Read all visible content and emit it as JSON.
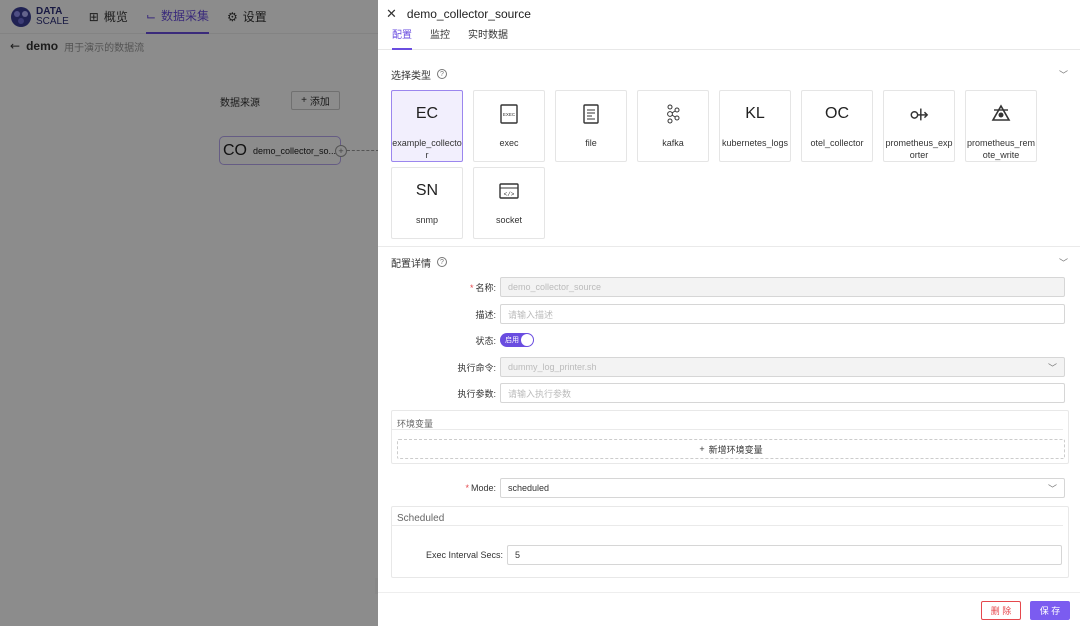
{
  "app": {
    "logo_line1": "DATA",
    "logo_line2": "SCALE",
    "nav": [
      {
        "label": "概览",
        "icon": "grid-icon"
      },
      {
        "label": "数据采集",
        "icon": "chart-icon",
        "active": true
      },
      {
        "label": "设置",
        "icon": "gear-icon"
      }
    ],
    "flow_name": "demo",
    "flow_desc": "用于演示的数据流",
    "canvas_label": "数据来源",
    "add_label": "添加",
    "node": {
      "abbr": "CO",
      "name": "demo_collector_so..."
    }
  },
  "drawer": {
    "title": "demo_collector_source",
    "tabs": [
      {
        "label": "配置",
        "active": true
      },
      {
        "label": "监控"
      },
      {
        "label": "实时数据"
      }
    ],
    "type_section_title": "选择类型",
    "types": [
      {
        "abbr": "EC",
        "label": "example_collector",
        "selected": true
      },
      {
        "icon": "exec-icon",
        "label": "exec"
      },
      {
        "icon": "file-icon",
        "label": "file"
      },
      {
        "icon": "kafka-icon",
        "label": "kafka"
      },
      {
        "abbr": "KL",
        "label": "kubernetes_logs"
      },
      {
        "abbr": "OC",
        "label": "otel_collector"
      },
      {
        "icon": "prometheus-exporter-icon",
        "label": "prometheus_exporter"
      },
      {
        "icon": "prometheus-remote-write-icon",
        "label": "prometheus_remote_write"
      },
      {
        "abbr": "SN",
        "label": "snmp"
      },
      {
        "icon": "socket-icon",
        "label": "socket"
      }
    ],
    "detail_section_title": "配置详情",
    "form": {
      "name_label": "名称:",
      "name_value": "demo_collector_source",
      "desc_label": "描述:",
      "desc_placeholder": "请输入描述",
      "status_label": "状态:",
      "status_toggle_text": "启用",
      "cmd_label": "执行命令:",
      "cmd_value": "dummy_log_printer.sh",
      "args_label": "执行参数:",
      "args_placeholder": "请输入执行参数",
      "env_title": "环境变量",
      "env_add_label": "新增环境变量",
      "mode_label": "Mode:",
      "mode_value": "scheduled",
      "scheduled_title": "Scheduled",
      "interval_label": "Exec Interval Secs:",
      "interval_value": "5"
    },
    "footer": {
      "delete_label": "删 除",
      "save_label": "保 存"
    }
  },
  "colors": {
    "accent": "#6a4de0",
    "danger": "#e5484d"
  }
}
